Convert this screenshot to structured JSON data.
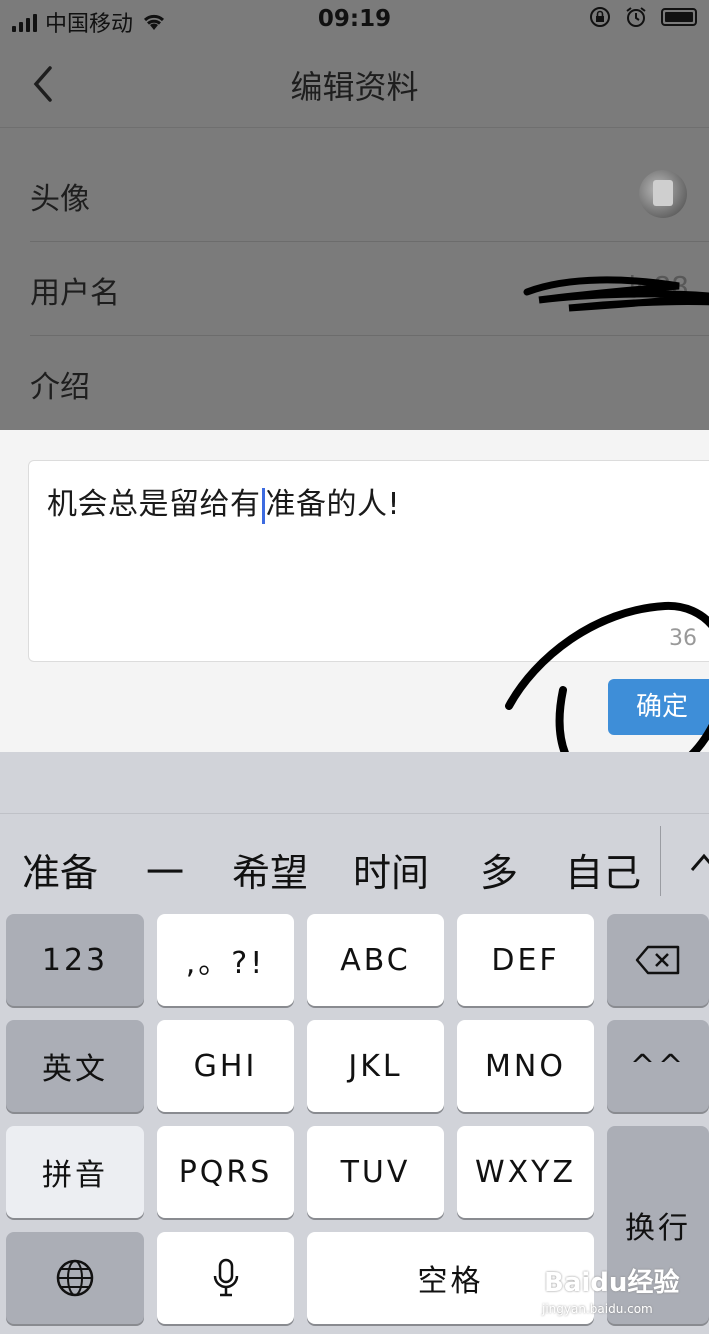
{
  "status_bar": {
    "carrier": "中国移动",
    "time": "09:19"
  },
  "nav": {
    "title": "编辑资料"
  },
  "form": {
    "rows": [
      {
        "label": "头像"
      },
      {
        "label": "用户名",
        "value": "...ie88"
      },
      {
        "label": "介绍"
      }
    ]
  },
  "editor": {
    "text_before_caret": "机会总是留给有",
    "text_after_caret": "准备的人!",
    "char_count": "36",
    "confirm_label": "确定"
  },
  "keyboard": {
    "candidates": [
      "准备",
      "一",
      "希望",
      "时间",
      "多",
      "自己"
    ],
    "keys": {
      "num": "123",
      "punct": ",。?!",
      "abc": "ABC",
      "def": "DEF",
      "english": "英文",
      "ghi": "GHI",
      "jkl": "JKL",
      "mno": "MNO",
      "emoji": "^^",
      "pinyin": "拼音",
      "pqrs": "PQRS",
      "tuv": "TUV",
      "wxyz": "WXYZ",
      "return": "换行",
      "space": "空格"
    }
  },
  "watermark": {
    "brand": "Baidu经验",
    "url": "jingyan.baidu.com"
  },
  "colors": {
    "accent": "#3e8ed8",
    "caret": "#3d6be0",
    "overlay": "#7b7b7b"
  }
}
